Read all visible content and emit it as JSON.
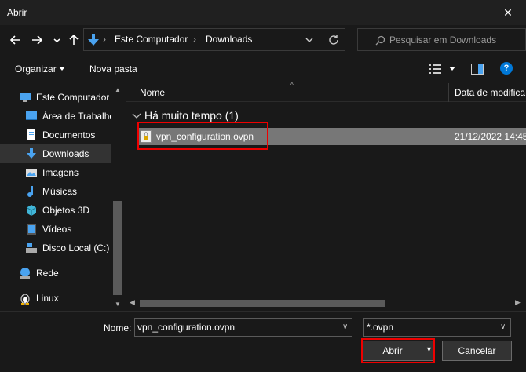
{
  "window": {
    "title": "Abrir",
    "close_glyph": "✕"
  },
  "nav": {
    "back_icon": "arrow-left-icon",
    "forward_icon": "arrow-right-icon",
    "recent_icon": "chevron-down-icon",
    "up_icon": "arrow-up-icon",
    "breadcrumb": [
      "Este Computador",
      "Downloads"
    ],
    "search_placeholder": "Pesquisar em Downloads"
  },
  "toolbar": {
    "organize_label": "Organizar",
    "new_folder_label": "Nova pasta"
  },
  "sidebar": {
    "items": [
      {
        "label": "Este Computador",
        "icon": "computer-icon"
      },
      {
        "label": "Área de Trabalhc",
        "icon": "desktop-icon"
      },
      {
        "label": "Documentos",
        "icon": "documents-icon"
      },
      {
        "label": "Downloads",
        "icon": "downloads-icon"
      },
      {
        "label": "Imagens",
        "icon": "pictures-icon"
      },
      {
        "label": "Músicas",
        "icon": "music-icon"
      },
      {
        "label": "Objetos 3D",
        "icon": "objects-3d-icon"
      },
      {
        "label": "Vídeos",
        "icon": "videos-icon"
      },
      {
        "label": "Disco Local (C:)",
        "icon": "drive-icon"
      },
      {
        "label": "Rede",
        "icon": "network-icon"
      },
      {
        "label": "Linux",
        "icon": "linux-icon"
      }
    ]
  },
  "files": {
    "columns": [
      "Nome",
      "Data de modifica"
    ],
    "group_label": "Há muito tempo (1)",
    "rows": [
      {
        "name": "vpn_configuration.ovpn",
        "date": "21/12/2022 14:45"
      }
    ]
  },
  "bottom": {
    "name_label": "Nome:",
    "filename": "vpn_configuration.ovpn",
    "filetype": "*.ovpn",
    "open_label": "Abrir",
    "cancel_label": "Cancelar"
  },
  "colors": {
    "background": "#191919",
    "selection": "#777777",
    "highlight": "#e00000",
    "accent": "#0078d7"
  }
}
